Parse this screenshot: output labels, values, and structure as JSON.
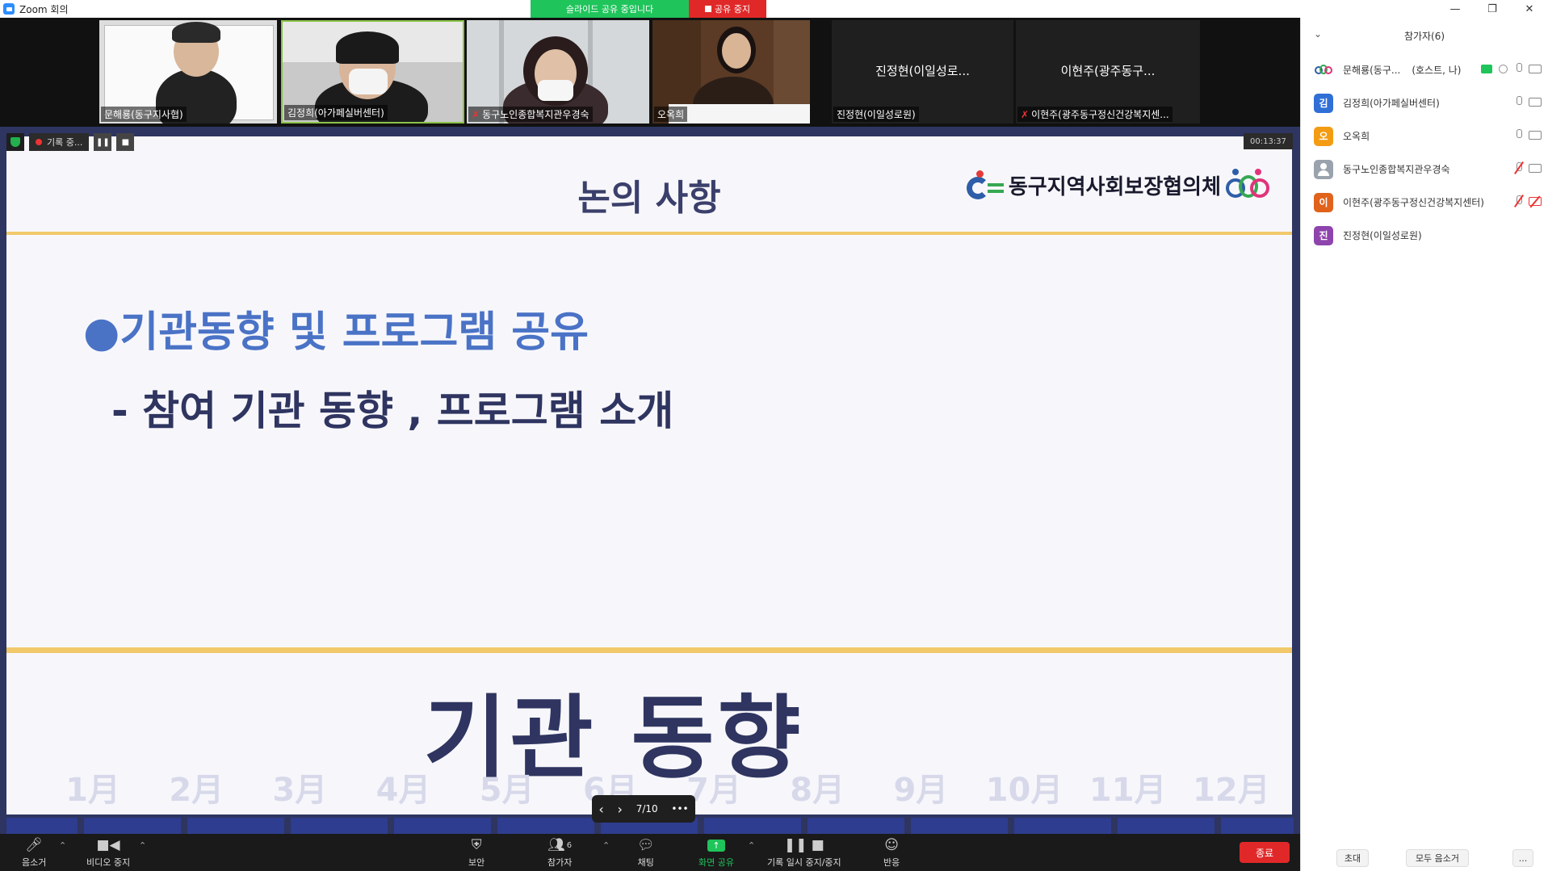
{
  "window": {
    "title": "Zoom 회의",
    "controls": [
      "—",
      "❐",
      "✕"
    ]
  },
  "share_banner": {
    "status": "슬라이드 공유 중입니다",
    "stop_label": "공유 중지"
  },
  "video_tiles": [
    {
      "name": "문해룡(동구지사협)",
      "muted": false
    },
    {
      "name": "김정희(아가페실버센터)",
      "muted": false
    },
    {
      "name": "동구노인종합복지관우경숙",
      "muted": true
    },
    {
      "name": "오옥희",
      "muted": false
    },
    {
      "name": "진정현(이일성로원)",
      "display": "진정현(이일성로...",
      "muted": false
    },
    {
      "name": "이현주(광주동구정신건강복지센...",
      "display": "이현주(광주동구...",
      "muted": true
    }
  ],
  "recording": {
    "label": "기록 중...",
    "timer": "00:13:37"
  },
  "slide": {
    "title": "논의 사항",
    "logo_text": "동구지역사회보장협의체",
    "bullet1": "●기관동향 및 프로그램 공유",
    "bullet2": "- 참여 기관 동향 , 프로그램 소개",
    "big_title": "기관 동향",
    "months": [
      "1月",
      "2月",
      "3月",
      "4月",
      "5月",
      "6月",
      "7月",
      "8月",
      "9月",
      "10月",
      "11月",
      "12月"
    ]
  },
  "slide_nav": {
    "page": "7/10",
    "prev": "‹",
    "next": "›",
    "more": "•••"
  },
  "toolbar": {
    "mute": "음소거",
    "video": "비디오 중지",
    "security": "보안",
    "participants": "참가자",
    "participants_count": "6",
    "chat": "채팅",
    "share": "화면 공유",
    "record": "기록 일시 중지/중지",
    "reactions": "반응",
    "end": "종료"
  },
  "panel": {
    "header": "참가자(6)",
    "participants": [
      {
        "name": "문해룡(동구...",
        "tag": "(호스트, 나)",
        "avatar": "logo",
        "color": "#ffffff"
      },
      {
        "name": "김정희(아가페실버센터)",
        "avatar": "김",
        "color": "#2f6fd6"
      },
      {
        "name": "오옥희",
        "avatar": "오",
        "color": "#f39c12"
      },
      {
        "name": "동구노인종합복지관우경숙",
        "avatar": "person",
        "color": "#9aa3ad"
      },
      {
        "name": "이현주(광주동구정신건강복지센터)",
        "avatar": "이",
        "color": "#e0621b"
      },
      {
        "name": "진정현(이일성로원)",
        "avatar": "진",
        "color": "#8e44ad"
      }
    ],
    "invite": "초대",
    "mute_all": "모두 음소거",
    "more": "..."
  }
}
